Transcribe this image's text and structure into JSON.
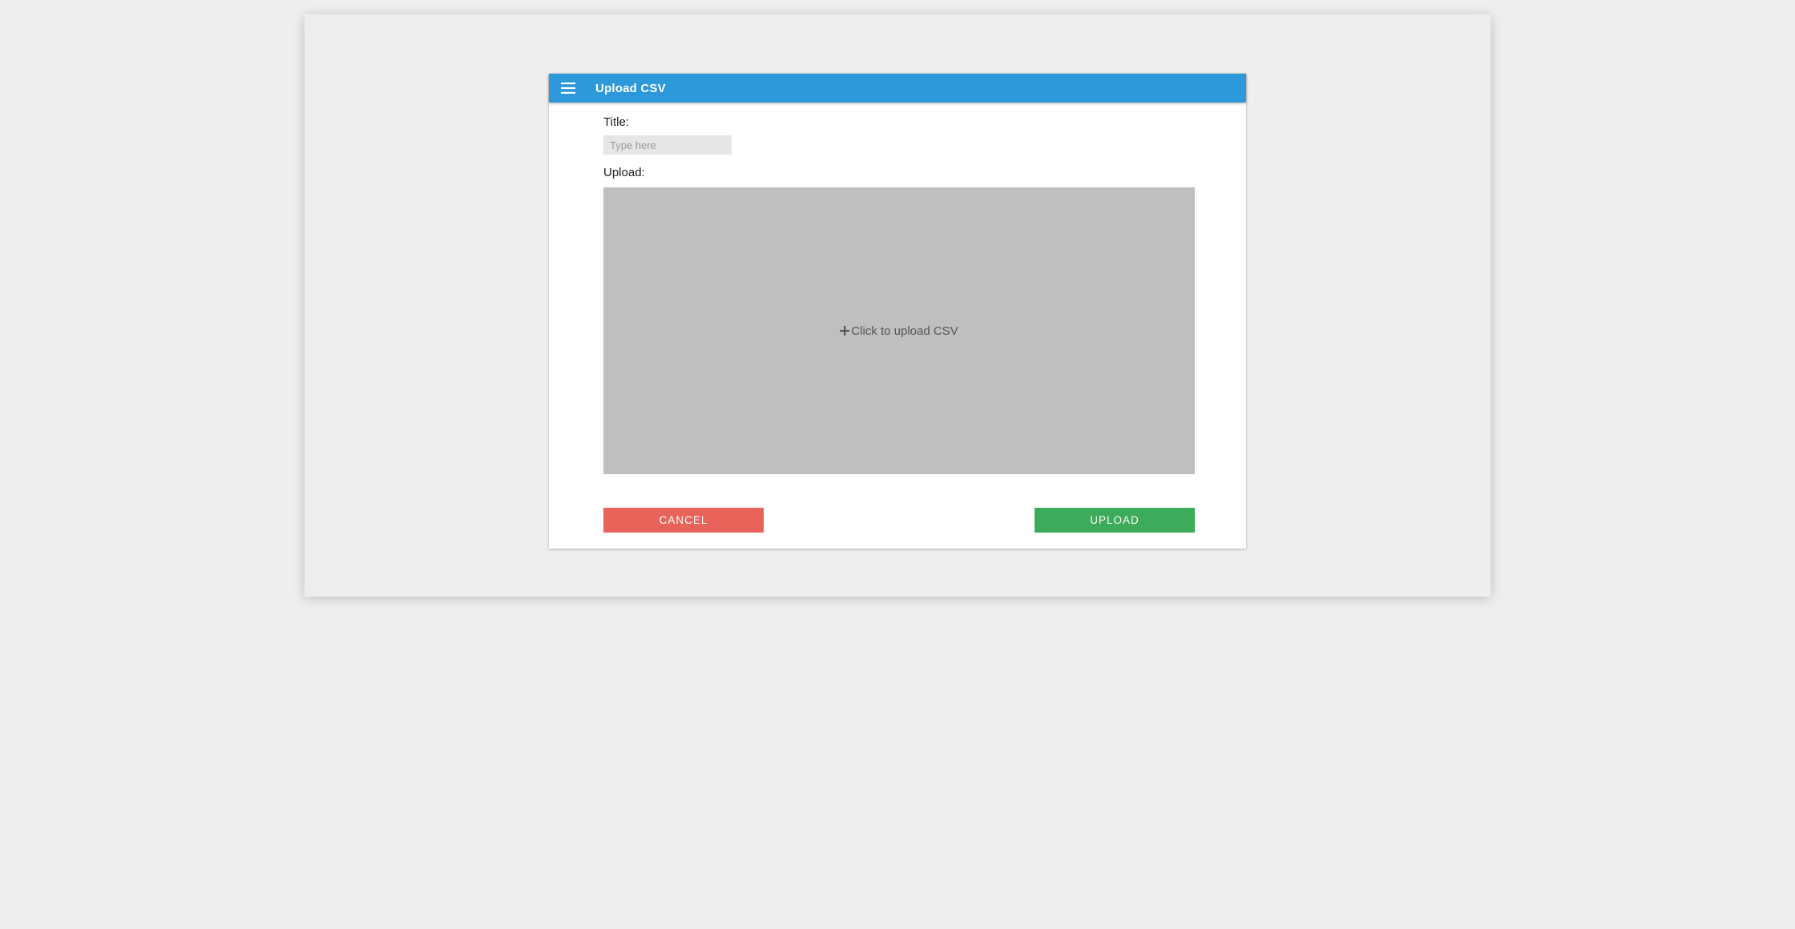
{
  "header": {
    "title": "Upload CSV"
  },
  "form": {
    "title_label": "Title:",
    "title_placeholder": "Type here",
    "title_value": "",
    "upload_label": "Upload:",
    "dropzone_text": "Click to upload CSV"
  },
  "actions": {
    "cancel_label": "CANCEL",
    "upload_label": "UPLOAD"
  },
  "colors": {
    "header_bg": "#2d98da",
    "cancel_bg": "#e8645a",
    "upload_bg": "#3cab5a",
    "dropzone_bg": "#bfbfbf"
  }
}
